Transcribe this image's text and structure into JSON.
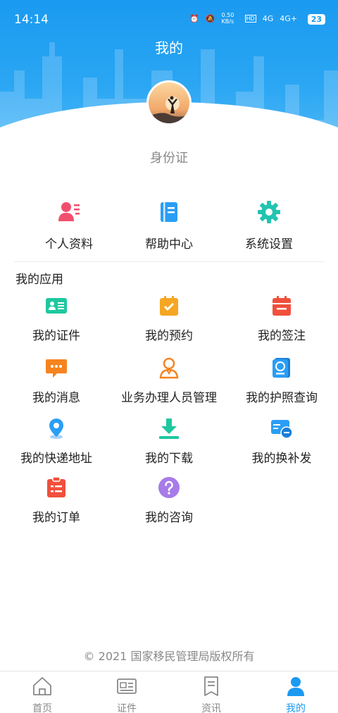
{
  "status": {
    "time": "14:14",
    "net_speed": "0.50 KB/s",
    "net1": "4G",
    "net2": "4G+",
    "battery": "23"
  },
  "header": {
    "title": "我的"
  },
  "profile": {
    "id_label": "身份证"
  },
  "quick_actions": [
    {
      "label": "个人资料",
      "icon": "profile-card-icon",
      "color": "#f0506e"
    },
    {
      "label": "帮助中心",
      "icon": "help-book-icon",
      "color": "#2a9ef5"
    },
    {
      "label": "系统设置",
      "icon": "gear-icon",
      "color": "#22c4b0"
    }
  ],
  "apps_section": {
    "title": "我的应用",
    "items": [
      {
        "label": "我的证件",
        "icon": "id-card-icon",
        "color": "#1fc8a0"
      },
      {
        "label": "我的预约",
        "icon": "appointment-icon",
        "color": "#f5a623"
      },
      {
        "label": "我的签注",
        "icon": "endorsement-icon",
        "color": "#f0503c"
      },
      {
        "label": "我的消息",
        "icon": "message-icon",
        "color": "#f5841f"
      },
      {
        "label": "业务办理人员管理",
        "icon": "staff-icon",
        "color": "#f5841f"
      },
      {
        "label": "我的护照查询",
        "icon": "passport-icon",
        "color": "#2a9ef5"
      },
      {
        "label": "我的快递地址",
        "icon": "location-pin-icon",
        "color": "#2a9ef5"
      },
      {
        "label": "我的下载",
        "icon": "download-icon",
        "color": "#1fc8a0"
      },
      {
        "label": "我的换补发",
        "icon": "reissue-icon",
        "color": "#2a9ef5"
      },
      {
        "label": "我的订单",
        "icon": "order-icon",
        "color": "#f0503c"
      },
      {
        "label": "我的咨询",
        "icon": "question-icon",
        "color": "#a77be8"
      }
    ]
  },
  "footer": {
    "copyright": "© 2021 国家移民管理局版权所有"
  },
  "tabbar": {
    "tabs": [
      {
        "label": "首页",
        "icon": "home-icon",
        "active": false
      },
      {
        "label": "证件",
        "icon": "certificate-icon",
        "active": false
      },
      {
        "label": "资讯",
        "icon": "news-icon",
        "active": false
      },
      {
        "label": "我的",
        "icon": "person-icon",
        "active": true
      }
    ]
  },
  "colors": {
    "accent": "#1a9af0",
    "text": "#222222",
    "muted": "#888888"
  }
}
